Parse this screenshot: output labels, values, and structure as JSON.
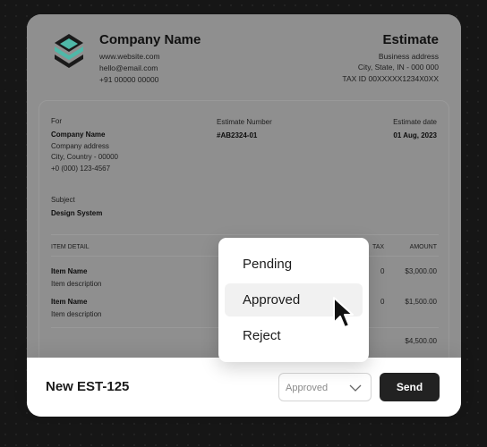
{
  "company": {
    "name": "Company Name",
    "website": "www.website.com",
    "email": "hello@email.com",
    "phone": "+91 00000 00000"
  },
  "estimate": {
    "title": "Estimate",
    "address1": "Business address",
    "address2": "City, State, IN - 000 000",
    "tax_id": "TAX ID 00XXXXX1234X0XX"
  },
  "billing": {
    "for_label": "For",
    "client_name": "Company Name",
    "client_address": "Company address",
    "client_city": "City, Country - 00000",
    "client_phone": "+0 (000) 123-4567",
    "number_label": "Estimate Number",
    "number_value": "#AB2324-01",
    "date_label": "Estimate date",
    "date_value": "01 Aug, 2023",
    "subject_label": "Subject",
    "subject_value": "Design System"
  },
  "table": {
    "headers": {
      "item": "ITEM DETAIL",
      "tax": "TAX",
      "amount": "AMOUNT"
    },
    "rows": [
      {
        "name": "Item Name",
        "desc": "Item description",
        "tax": "0",
        "amount": "$3,000.00"
      },
      {
        "name": "Item Name",
        "desc": "Item description",
        "tax": "0",
        "amount": "$1,500.00"
      }
    ],
    "total": "$4,500.00"
  },
  "bottom": {
    "estimate_id": "New EST-125",
    "status_value": "Approved",
    "send_label": "Send"
  },
  "dropdown": {
    "options": [
      "Pending",
      "Approved",
      "Reject"
    ],
    "highlighted": "Approved"
  },
  "colors": {
    "dark_button": "#222222",
    "page_background": "#161616",
    "logo_teal": "#4fb8a8"
  },
  "icons": [
    "logo-icon",
    "chevron-down-icon",
    "cursor-icon"
  ]
}
